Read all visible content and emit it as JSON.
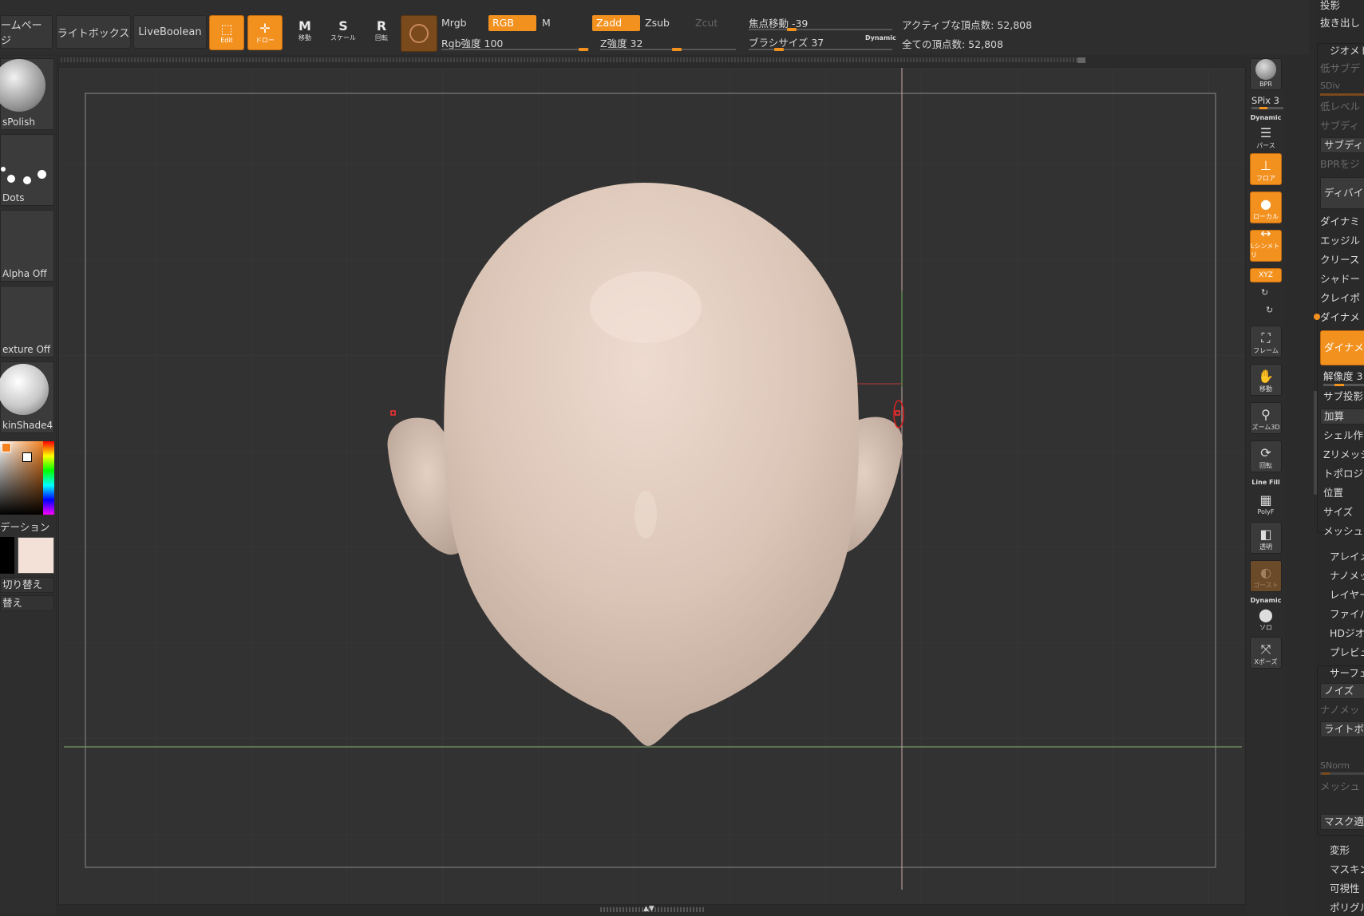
{
  "top": {
    "tab_home": "ームページ",
    "tab_lightbox": "ライトボックス",
    "tab_liveboolean": "LiveBoolean",
    "edit_label": "Edit",
    "draw_label": "ドロー",
    "move_label": "移動",
    "scale_label": "スケール",
    "rotate_label": "回転",
    "mrgb": "Mrgb",
    "rgb": "RGB",
    "m": "M",
    "zadd": "Zadd",
    "zsub": "Zsub",
    "zcut": "Zcut",
    "rgb_intensity": "Rgb強度 100",
    "z_intensity": "Z強度 32",
    "focal_shift": "焦点移動 -39",
    "brush_size": "ブラシサイズ 37",
    "dynamic": "Dynamic",
    "active_points": "アクティブな頂点数: 52,808",
    "total_points": "全ての頂点数: 52,808"
  },
  "left": {
    "brush_name": "sPolish",
    "stroke_name": "Dots",
    "alpha_name": "Alpha Off",
    "texture_name": "exture Off",
    "material_name": "kinShade4",
    "gradient": "デーション",
    "switch_color": "切り替え",
    "alternate": "替え"
  },
  "colors": {
    "accent": "#f3911f",
    "secondary_color": "#f3e0d6",
    "model_skin": "#d9c4b5"
  },
  "shelf": {
    "bpr": "BPR",
    "spix": "SPix 3",
    "dynamic": "Dynamic",
    "perspective": "パース",
    "floor": "フロア",
    "local": "ローカル",
    "lsym": "Lシンメトリ",
    "xyz": "XYZ",
    "frame": "フレーム",
    "move": "移動",
    "zoom3d": "ズーム3D",
    "rotate": "回転",
    "linefill": "Line Fill",
    "polyf": "PolyF",
    "transparent": "透明",
    "ghost": "ゴースト",
    "dynamic2": "Dynamic",
    "solo": "ソロ",
    "xpose": "Xポーズ"
  },
  "palette": {
    "projection": "投影",
    "extract": "抜き出し",
    "geometry": "ジオメト",
    "lower_subdiv": "低サブデ",
    "sdiv": "SDiv",
    "lower_level": "低レベル",
    "subdiv": "サブディ",
    "subdiv2": "サブディ",
    "bpr_to_geo": "BPRをジ",
    "divide": "ディバイ",
    "dynamic": "ダイナミ",
    "edge": "エッジル",
    "crease": "クリース",
    "shadow": "シャドー",
    "claypolish": "クレイポ",
    "dynamesh_header": "ダイナメ",
    "dynamesh_btn": "ダイナメ",
    "resolution": "解像度 3",
    "sub_proj": "サブ投影",
    "add": "加算",
    "shell": "シェル作",
    "zremesh": "Zリメッシ",
    "topology": "トポロジ",
    "position": "位置",
    "size": "サイズ",
    "mesh": "メッシュ",
    "array": "アレイメ",
    "nanomesh": "ナノメッ",
    "layers": "レイヤー",
    "fibermesh": "ファイバ",
    "hdgeo": "HDジオメ",
    "preview": "プレビュ",
    "surface": "サーフェ",
    "noise": "ノイズ",
    "nanomesh2": "ナノメッ",
    "lightbox": "ライトボ",
    "snorm": "SNorm",
    "mesh2": "メッシュ",
    "mask_apply": "マスク適",
    "deform": "変形",
    "masking": "マスキン",
    "visibility": "可視性",
    "polygroups": "ポリグル"
  }
}
